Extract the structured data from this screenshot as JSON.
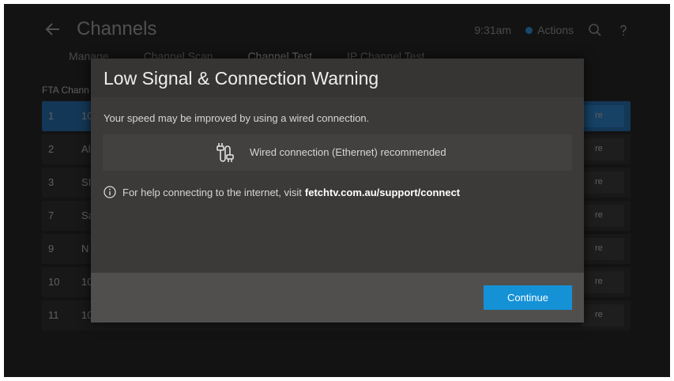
{
  "app": {
    "title": "Channels",
    "time": "9:31am",
    "actions_label": "Actions"
  },
  "tabs": [
    {
      "label": "Manage"
    },
    {
      "label": "Channel Scan"
    },
    {
      "label": "Channel Test"
    },
    {
      "label": "IP Channel Test"
    }
  ],
  "table": {
    "header": "FTA Chann",
    "rows": [
      {
        "num": "1",
        "name": "10"
      },
      {
        "num": "2",
        "name": "Al"
      },
      {
        "num": "3",
        "name": "SI"
      },
      {
        "num": "7",
        "name": "Sa"
      },
      {
        "num": "9",
        "name": "N"
      },
      {
        "num": "10",
        "name": "10"
      },
      {
        "num": "11",
        "name": "10"
      }
    ],
    "row_button_label": "re"
  },
  "modal": {
    "title": "Low Signal & Connection Warning",
    "message": "Your speed may be improved by using a wired connection.",
    "recommendation": "Wired connection (Ethernet) recommended",
    "help_prefix": "For help connecting to the internet, visit",
    "help_link": "fetchtv.com.au/support/connect",
    "continue_label": "Continue"
  },
  "colors": {
    "accent": "#1591d6",
    "selected_row": "#1464a8"
  },
  "icons": {
    "back": "arrow-left-icon",
    "actions": "blue-dot-icon",
    "search": "search-icon",
    "help": "question-mark-icon",
    "ethernet": "ethernet-icon",
    "info": "info-icon"
  }
}
